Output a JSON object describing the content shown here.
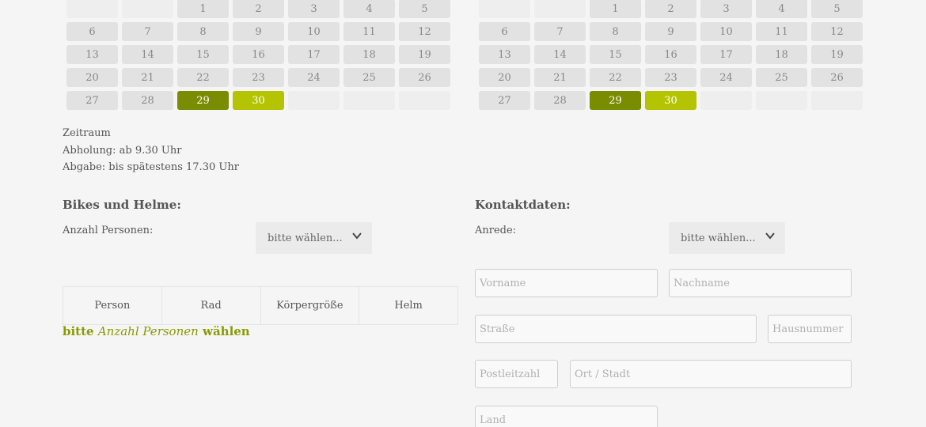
{
  "calendars": [
    {
      "weeks": [
        [
          "",
          "",
          "1",
          "2",
          "3",
          "4",
          "5"
        ],
        [
          "6",
          "7",
          "8",
          "9",
          "10",
          "11",
          "12"
        ],
        [
          "13",
          "14",
          "15",
          "16",
          "17",
          "18",
          "19"
        ],
        [
          "20",
          "21",
          "22",
          "23",
          "24",
          "25",
          "26"
        ],
        [
          "27",
          "28",
          "29",
          "30",
          "",
          "",
          ""
        ]
      ],
      "selected_start": "29",
      "selected_end": "30"
    },
    {
      "weeks": [
        [
          "",
          "",
          "1",
          "2",
          "3",
          "4",
          "5"
        ],
        [
          "6",
          "7",
          "8",
          "9",
          "10",
          "11",
          "12"
        ],
        [
          "13",
          "14",
          "15",
          "16",
          "17",
          "18",
          "19"
        ],
        [
          "20",
          "21",
          "22",
          "23",
          "24",
          "25",
          "26"
        ],
        [
          "27",
          "28",
          "29",
          "30",
          "",
          "",
          ""
        ]
      ],
      "selected_start": "29",
      "selected_end": "30"
    }
  ],
  "period": {
    "title": "Zeitraum",
    "pickup": "Abholung: ab 9.30 Uhr",
    "return": "Abgabe: bis spätestens 17.30 Uhr"
  },
  "bikes": {
    "heading": "Bikes und Helme:",
    "persons_label": "Anzahl Personen:",
    "persons_select": "bitte wählen...",
    "columns": [
      "Person",
      "Rad",
      "Körpergröße",
      "Helm"
    ],
    "hint_pre": "bitte",
    "hint_em": "Anzahl Personen",
    "hint_post": "wählen"
  },
  "contact": {
    "heading": "Kontaktdaten:",
    "salutation_label": "Anrede:",
    "salutation_select": "bitte wählen...",
    "firstname_placeholder": "Vorname",
    "lastname_placeholder": "Nachname",
    "street_placeholder": "Straße",
    "housenumber_placeholder": "Hausnummer",
    "zip_placeholder": "Postleitzahl",
    "city_placeholder": "Ort / Stadt",
    "country_placeholder": "Land"
  },
  "colors": {
    "accent_dark": "#7a8c00",
    "accent_light": "#b4c400",
    "hint_text": "#8a9a00"
  }
}
